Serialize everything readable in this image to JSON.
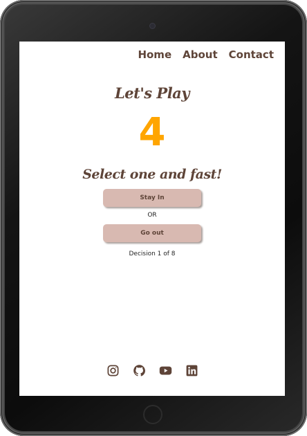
{
  "nav": {
    "items": [
      "Home",
      "About",
      "Contact"
    ]
  },
  "game": {
    "title": "Let's Play",
    "countdown": "4",
    "prompt": "Select one and fast!",
    "option_a": "Stay In",
    "separator": "OR",
    "option_b": "Go out",
    "progress": "Decision 1 of 8"
  },
  "footer": {
    "social_icons": [
      "instagram-icon",
      "github-icon",
      "youtube-icon",
      "linkedin-icon"
    ]
  },
  "colors": {
    "brand_brown": "#5e4438",
    "countdown_orange": "#ffa500",
    "button_bg": "#d8b9b1"
  }
}
